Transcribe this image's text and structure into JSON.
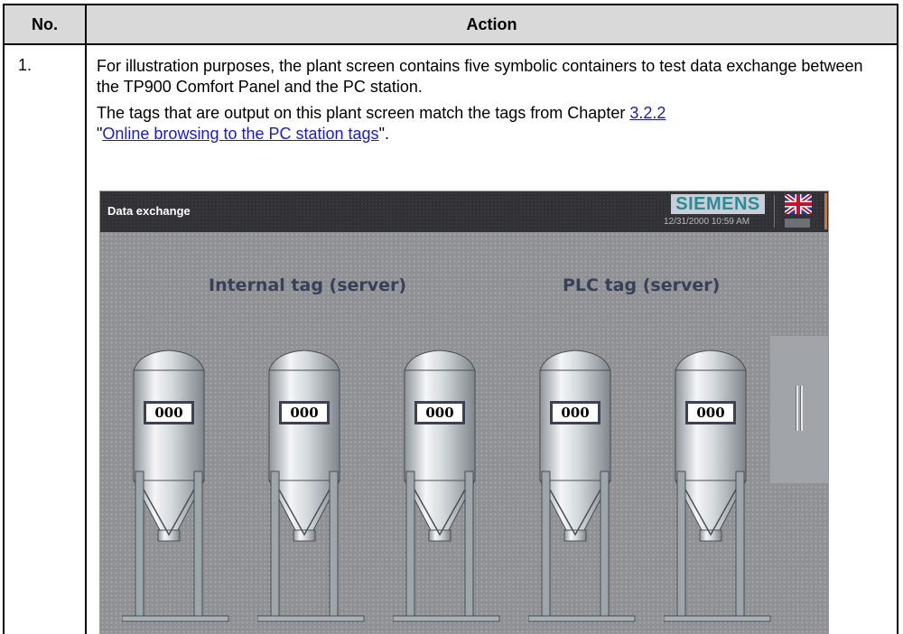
{
  "table": {
    "header_no": "No.",
    "header_action": "Action"
  },
  "step": {
    "number": "1.",
    "para1": "For illustration purposes, the plant screen contains five symbolic containers to test data exchange between the TP900 Comfort Panel and the PC station.",
    "para2_prefix": "The tags that are output on this plant screen match the tags from Chapter ",
    "chapter_link": "3.2.2",
    "para2_quote_open": "\"",
    "section_link": "Online browsing to the PC station tags",
    "para2_suffix": "\"."
  },
  "hmi": {
    "title": "Data exchange",
    "brand": "SIEMENS",
    "datetime": "12/31/2000 10:59 AM",
    "label_internal": "Internal tag (server)",
    "label_plc": "PLC tag (server)",
    "tanks": [
      {
        "value": "000"
      },
      {
        "value": "000"
      },
      {
        "value": "000"
      },
      {
        "value": "000"
      },
      {
        "value": "000"
      }
    ],
    "icons": {
      "flag": "uk-flag-icon",
      "keyboard": "keyboard-icon"
    }
  }
}
